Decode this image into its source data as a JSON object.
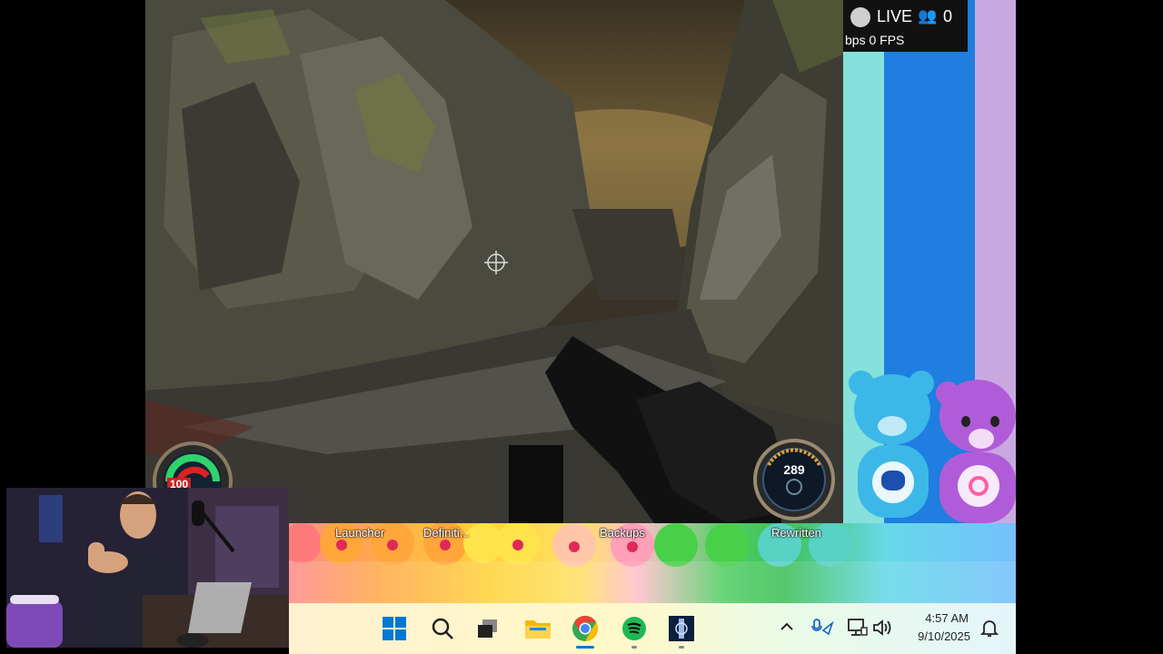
{
  "live_overlay": {
    "live_label": "LIVE",
    "viewer_count": "0",
    "stats": "bps 0 FPS",
    "viewers_icon": "people-icon"
  },
  "hud": {
    "ammo": "289",
    "health": "100"
  },
  "desktop": {
    "icons": [
      {
        "label": "Launcher"
      },
      {
        "label": "Definiti..."
      },
      {
        "label": "Backups"
      },
      {
        "label": "Rewritten"
      }
    ]
  },
  "taskbar": {
    "apps": [
      {
        "name": "start",
        "icon": "windows-icon"
      },
      {
        "name": "search",
        "icon": "search-icon"
      },
      {
        "name": "task-view",
        "icon": "task-view-icon"
      },
      {
        "name": "file-explorer",
        "icon": "folder-icon"
      },
      {
        "name": "chrome",
        "icon": "chrome-icon"
      },
      {
        "name": "spotify",
        "icon": "spotify-icon"
      },
      {
        "name": "game",
        "icon": "game-app-icon"
      }
    ],
    "tray": {
      "chevron": "chevron-up-icon",
      "time": "4:57 AM",
      "date": "9/10/2025"
    }
  },
  "colors": {
    "start_blue": "#0078d4",
    "chrome_red": "#ea4335",
    "spotify_green": "#1db954",
    "hud_green": "#2fd36a",
    "hud_red": "#d22"
  }
}
